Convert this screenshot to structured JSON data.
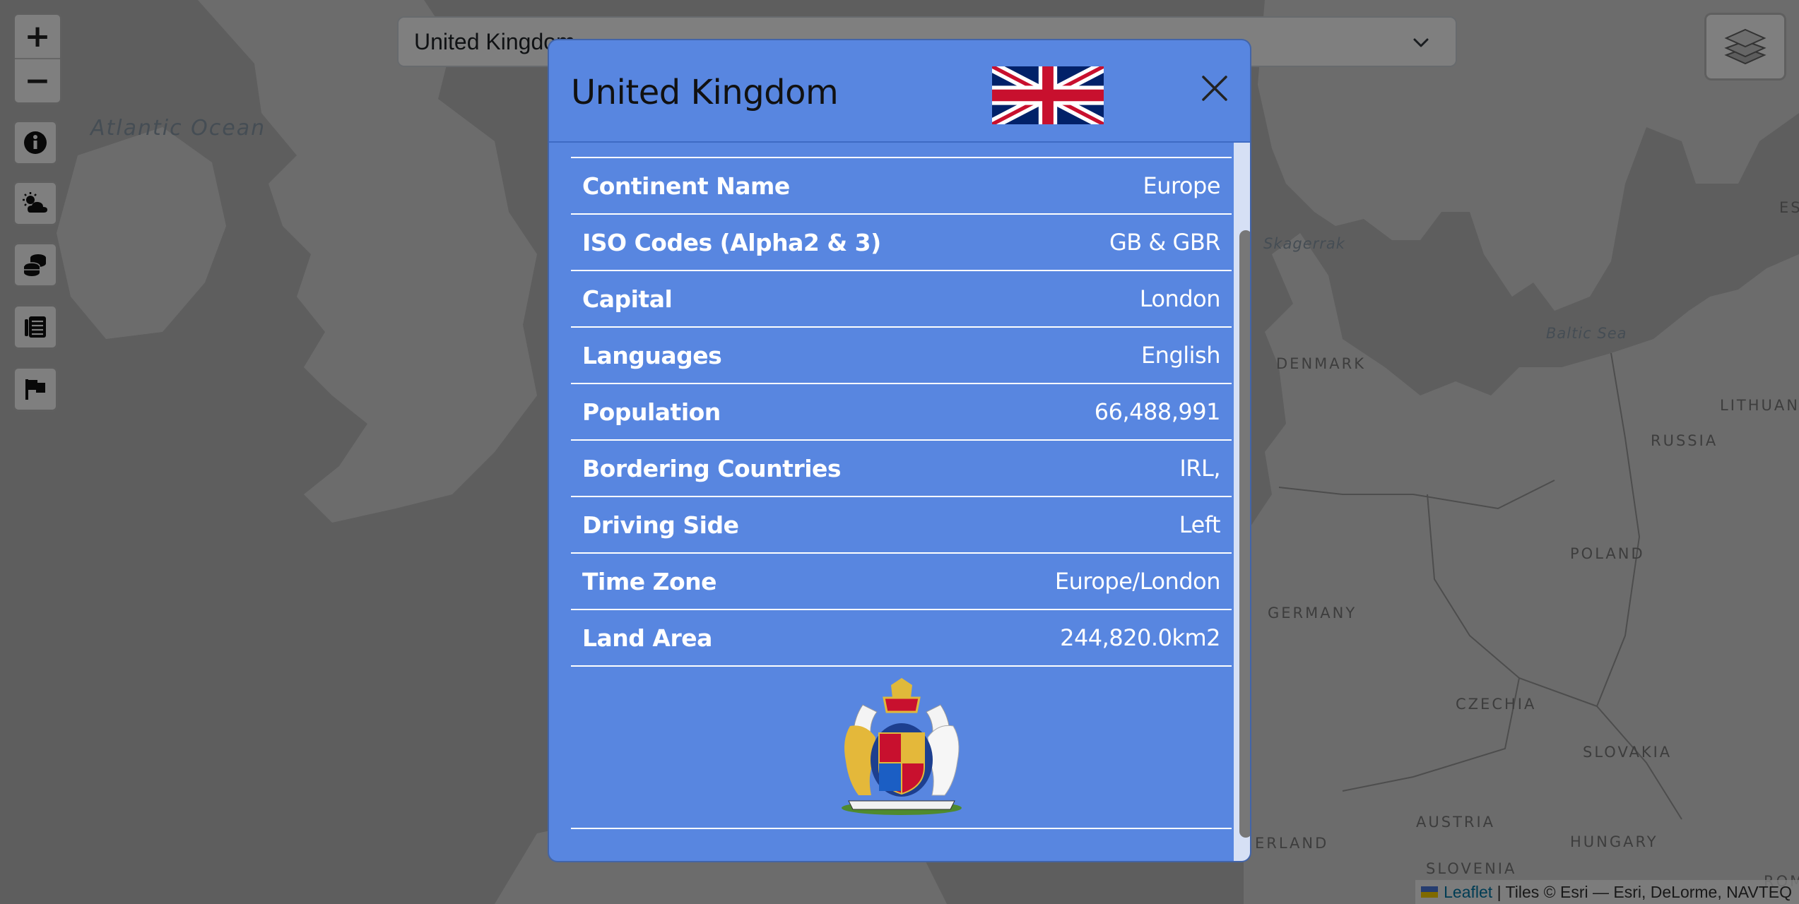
{
  "map": {
    "labels": {
      "ocean": "Atlantic Ocean",
      "skagerrak": "Skagerrak",
      "baltic": "Baltic Sea",
      "denmark": "DENMARK",
      "germany": "GERMANY",
      "poland": "POLAND",
      "russia": "RUSSIA",
      "lithuania": "LITHUANI",
      "czechia": "CZECHIA",
      "slovakia": "SLOVAKIA",
      "austria": "AUSTRIA",
      "hungary": "HUNGARY",
      "slovenia": "SLOVENIA",
      "switzerland": "ERLAND",
      "estonia": "ES",
      "roma": "ROMA"
    },
    "colors": {
      "land": "#d9d9d9",
      "water": "#bdbdbd"
    }
  },
  "controls": {
    "zoom_in": "+",
    "zoom_out": "−",
    "buttons": [
      "info-icon",
      "weather-icon",
      "currency-icon",
      "news-icon",
      "flag-icon"
    ]
  },
  "country_select": {
    "value": "United Kingdom"
  },
  "attribution": {
    "leaflet": "Leaflet",
    "tiles": "| Tiles © Esri — Esri, DeLorme, NAVTEQ"
  },
  "modal": {
    "title": "United Kingdom",
    "rows": [
      {
        "label": "Continent Name",
        "value": "Europe"
      },
      {
        "label": "ISO Codes (Alpha2 & 3)",
        "value": "GB & GBR"
      },
      {
        "label": "Capital",
        "value": "London"
      },
      {
        "label": "Languages",
        "value": "English"
      },
      {
        "label": "Population",
        "value": "66,488,991"
      },
      {
        "label": "Bordering Countries",
        "value": "IRL,"
      },
      {
        "label": "Driving Side",
        "value": "Left"
      },
      {
        "label": "Time Zone",
        "value": "Europe/London"
      },
      {
        "label": "Land Area",
        "value": "244,820.0km2"
      }
    ],
    "colors": {
      "background": "#5886e0",
      "text": "#ffffff"
    }
  }
}
